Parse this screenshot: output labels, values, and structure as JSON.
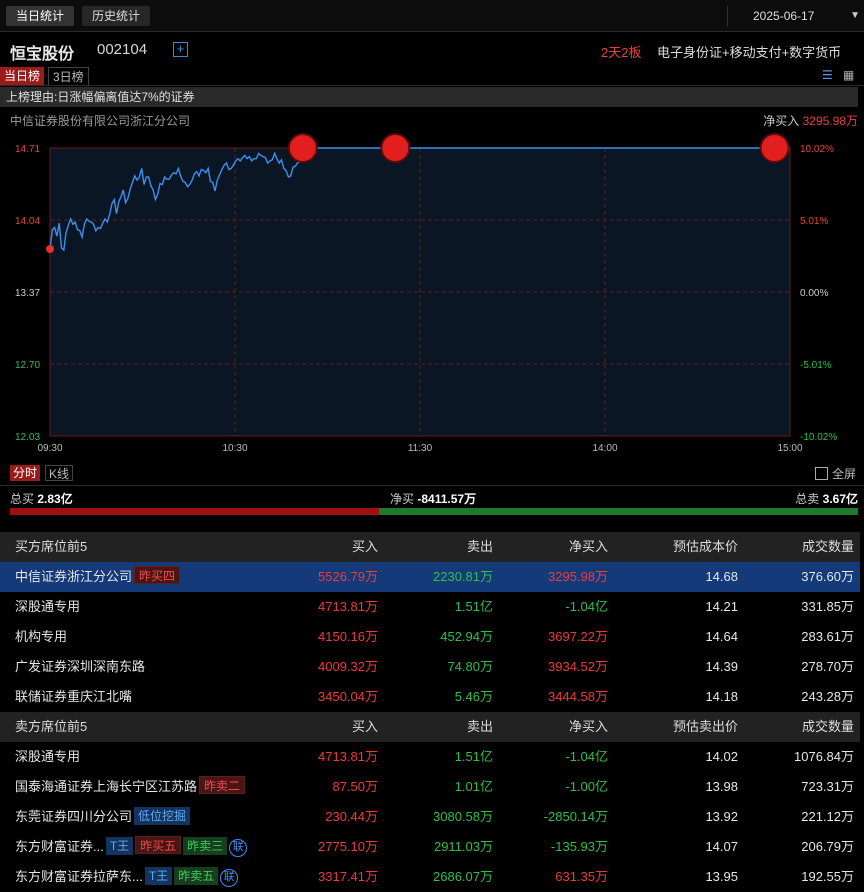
{
  "header": {
    "tabs": [
      {
        "label": "当日统计",
        "active": true
      },
      {
        "label": "历史统计",
        "active": false
      }
    ],
    "date": "2025-06-17"
  },
  "stock": {
    "name": "恒宝股份",
    "code": "002104",
    "board": "2天2板",
    "concepts": "电子身份证+移动支付+数字货币"
  },
  "subtabs": [
    {
      "label": "当日榜",
      "active": true
    },
    {
      "label": "3日榜",
      "active": false
    }
  ],
  "reason": "上榜理由:日涨幅偏离值达7%的证券",
  "broker": {
    "name": "中信证券股份有限公司浙江分公司",
    "net_label": "净买入",
    "net_value": "3295.98万"
  },
  "chart_data": {
    "type": "line",
    "y_left_ticks": [
      "14.71",
      "14.04",
      "13.37",
      "12.70",
      "12.03"
    ],
    "y_right_ticks": [
      "10.02%",
      "5.01%",
      "0.00%",
      "-5.01%",
      "-10.02%"
    ],
    "x_ticks": [
      "09:30",
      "10:30",
      "11:30",
      "14:00",
      "15:00"
    ],
    "ylim": [
      12.03,
      14.71
    ],
    "prev_close": 13.37,
    "limit_up_price": 14.71,
    "series": [
      {
        "values": [
          13.77,
          13.95,
          13.97,
          13.89,
          14.01,
          13.78,
          13.76,
          13.92,
          13.99,
          14.05,
          14.0,
          14.02,
          13.95,
          13.94,
          13.88,
          14.0,
          14.05,
          14.03,
          14.02,
          14.0,
          13.94,
          13.97,
          13.96,
          14.01,
          14.05,
          14.02,
          14.09,
          14.19,
          14.23,
          14.1,
          14.21,
          14.26,
          14.32,
          14.2,
          14.24,
          14.33,
          14.39,
          14.45,
          14.41,
          14.44,
          14.52,
          14.37,
          14.44,
          14.44,
          14.36,
          14.32,
          14.23,
          14.28,
          14.38,
          14.37,
          14.44,
          14.42,
          14.42,
          14.46,
          14.48,
          14.47,
          14.52,
          14.45,
          14.4,
          14.39,
          14.35,
          14.37,
          14.41,
          14.47,
          14.49,
          14.45,
          14.51,
          14.5,
          14.48,
          14.52,
          14.4,
          14.39,
          14.31,
          14.41,
          14.46,
          14.51,
          14.55,
          14.57,
          14.51,
          14.52,
          14.55,
          14.59,
          14.61,
          14.59,
          14.62,
          14.64,
          14.61,
          14.63,
          14.59,
          14.61,
          14.61,
          14.66,
          14.64,
          14.63,
          14.62,
          14.57,
          14.59,
          14.6,
          14.66,
          14.61,
          14.57,
          14.6,
          14.52,
          14.5,
          14.44,
          14.45,
          14.53,
          14.54,
          14.57,
          14.58,
          14.62,
          14.64,
          14.66,
          14.71
        ]
      }
    ]
  },
  "chart_tabs": [
    {
      "label": "分时",
      "active": true
    },
    {
      "label": "K线",
      "active": false
    }
  ],
  "fullscreen_label": "全屏",
  "summary": {
    "buy_label": "总买",
    "buy_value": "2.83亿",
    "net_label": "净买",
    "net_value": "-8411.57万",
    "sell_label": "总卖",
    "sell_value": "3.67亿",
    "buy_ratio": 0.435
  },
  "buy_table": {
    "headers": [
      "买方席位前5",
      "买入",
      "卖出",
      "净买入",
      "预估成本价",
      "成交数量"
    ],
    "rows": [
      {
        "name": "中信证券浙江分公司",
        "tags": [
          {
            "text": "昨买四",
            "style": "r"
          }
        ],
        "buy": "5526.79万",
        "sell": "2230.81万",
        "net": "3295.98万",
        "net_color": "red",
        "price": "14.68",
        "qty": "376.60万",
        "selected": true
      },
      {
        "name": "深股通专用",
        "tags": [],
        "buy": "4713.81万",
        "sell": "1.51亿",
        "net": "-1.04亿",
        "net_color": "green",
        "price": "14.21",
        "qty": "331.85万"
      },
      {
        "name": "机构专用",
        "tags": [],
        "buy": "4150.16万",
        "sell": "452.94万",
        "net": "3697.22万",
        "net_color": "red",
        "price": "14.64",
        "qty": "283.61万"
      },
      {
        "name": "广发证券深圳深南东路",
        "tags": [],
        "buy": "4009.32万",
        "sell": "74.80万",
        "net": "3934.52万",
        "net_color": "red",
        "price": "14.39",
        "qty": "278.70万"
      },
      {
        "name": "联储证券重庆江北嘴",
        "tags": [],
        "buy": "3450.04万",
        "sell": "5.46万",
        "net": "3444.58万",
        "net_color": "red",
        "price": "14.18",
        "qty": "243.28万"
      }
    ]
  },
  "sell_table": {
    "headers": [
      "卖方席位前5",
      "买入",
      "卖出",
      "净买入",
      "预估卖出价",
      "成交数量"
    ],
    "rows": [
      {
        "name": "深股通专用",
        "tags": [],
        "buy": "4713.81万",
        "sell": "1.51亿",
        "net": "-1.04亿",
        "net_color": "green",
        "price": "14.02",
        "qty": "1076.84万"
      },
      {
        "name": "国泰海通证券上海长宁区江苏路",
        "tags": [
          {
            "text": "昨卖二",
            "style": "r"
          }
        ],
        "buy": "87.50万",
        "sell": "1.01亿",
        "net": "-1.00亿",
        "net_color": "green",
        "price": "13.98",
        "qty": "723.31万"
      },
      {
        "name": "东莞证券四川分公司",
        "tags": [
          {
            "text": "低位挖掘",
            "style": "b"
          }
        ],
        "buy": "230.44万",
        "sell": "3080.58万",
        "net": "-2850.14万",
        "net_color": "green",
        "price": "13.92",
        "qty": "221.12万"
      },
      {
        "name": "东方财富证券...",
        "tags": [
          {
            "text": "T王",
            "style": "b"
          },
          {
            "text": "昨买五",
            "style": "r"
          },
          {
            "text": "昨卖三",
            "style": "g"
          },
          {
            "text": "联",
            "style": "circle"
          }
        ],
        "buy": "2775.10万",
        "sell": "2911.03万",
        "net": "-135.93万",
        "net_color": "green",
        "price": "14.07",
        "qty": "206.79万"
      },
      {
        "name": "东方财富证券拉萨东...",
        "tags": [
          {
            "text": "T王",
            "style": "b"
          },
          {
            "text": "昨卖五",
            "style": "g"
          },
          {
            "text": "联",
            "style": "circle"
          }
        ],
        "buy": "3317.41万",
        "sell": "2686.07万",
        "net": "631.35万",
        "net_color": "red",
        "price": "13.95",
        "qty": "192.55万"
      }
    ]
  }
}
